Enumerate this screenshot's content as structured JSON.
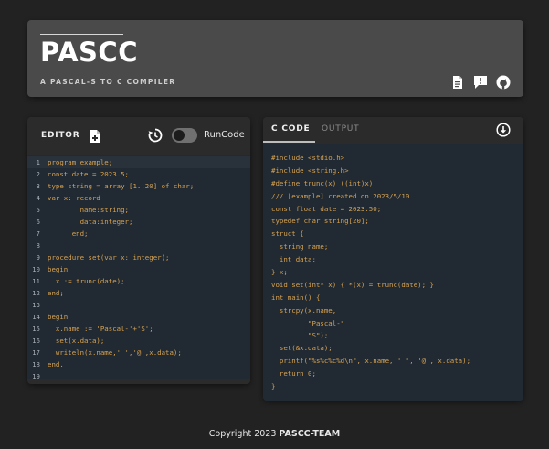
{
  "header": {
    "logo": "PASCC",
    "tagline": "A PASCAL-S TO C COMPILER",
    "icons": [
      "document-icon",
      "feedback-icon",
      "github-icon"
    ]
  },
  "editor": {
    "title": "EDITOR",
    "run_label": "RunCode",
    "run_enabled": false,
    "lines": [
      "program example;",
      "const date = 2023.5;",
      "type string = array [1..20] of char;",
      "var x: record",
      "        name:string;",
      "        data:integer;",
      "      end;",
      "",
      "procedure set(var x: integer);",
      "begin",
      "  x := trunc(date);",
      "end;",
      "",
      "begin",
      "  x.name := 'Pascal-'+'S';",
      "  set(x.data);",
      "  writeln(x.name,' ','@',x.data);",
      "end.",
      ""
    ]
  },
  "output": {
    "tabs": [
      "C CODE",
      "OUTPUT"
    ],
    "active_tab": "C CODE",
    "lines": [
      "#include <stdio.h>",
      "#include <string.h>",
      "#define trunc(x) ((int)x)",
      "/// [example] created on 2023/5/10",
      "const float date = 2023.50;",
      "typedef char string[20];",
      "struct {",
      "  string name;",
      "  int data;",
      "} x;",
      "void set(int* x) { *(x) = trunc(date); }",
      "int main() {",
      "  strcpy(x.name,",
      "         \"Pascal-\"",
      "         \"S\");",
      "  set(&x.data);",
      "  printf(\"%s%c%c%d\\n\", x.name, ' ', '@', x.data);",
      "  return 0;",
      "}"
    ]
  },
  "footer": {
    "prefix": "Copyright 2023 ",
    "team": "PASCC-TEAM"
  },
  "colors": {
    "background": "#222222",
    "header": "#4a4a4a",
    "code_bg": "#212a33",
    "code_text": "#d8a24f"
  }
}
